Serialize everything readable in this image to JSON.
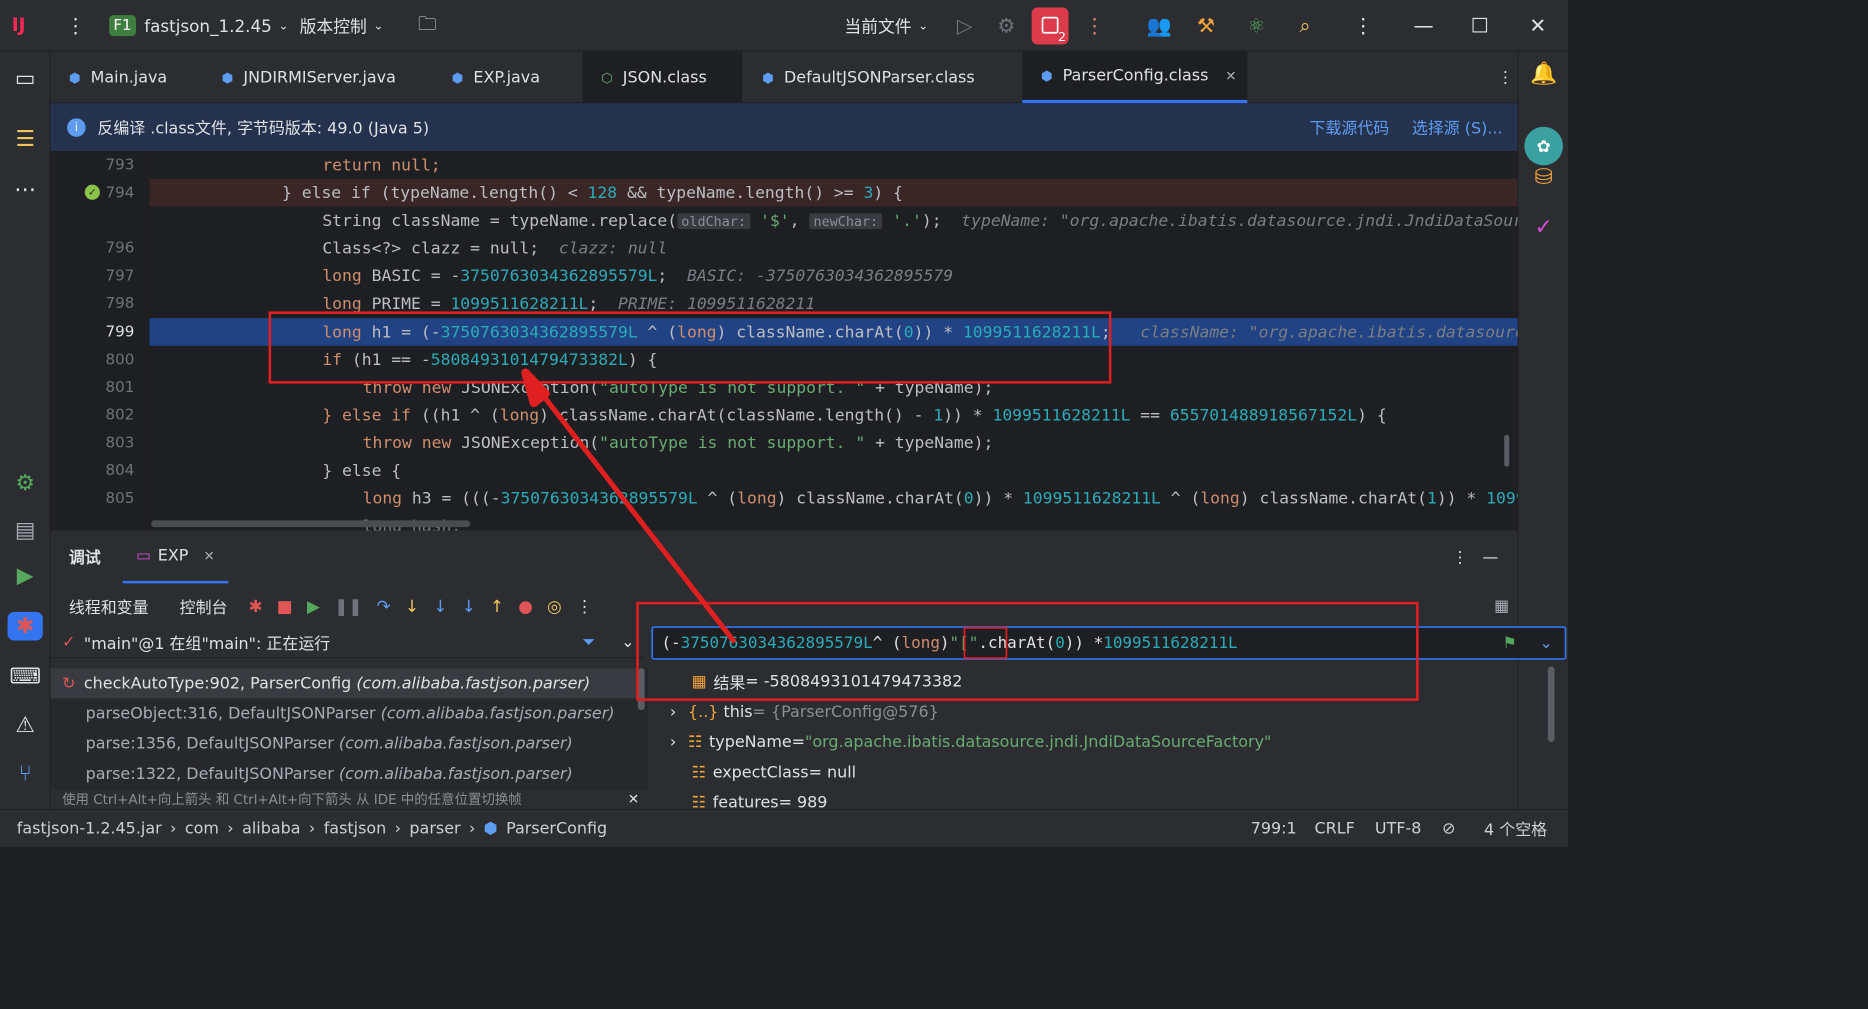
{
  "titlebar": {
    "project": "fastjson_1.2.45",
    "project_badge": "F1",
    "vcs": "版本控制",
    "run_config": "当前文件",
    "notif_count": "2"
  },
  "tabs": [
    "Main.java",
    "JNDIRMIServer.java",
    "EXP.java",
    "JSON.class",
    "DefaultJSONParser.class",
    "ParserConfig.class"
  ],
  "infobar": {
    "text": "反编译 .class文件, 字节码版本: 49.0 (Java 5)",
    "download": "下载源代码",
    "choose": "选择源 (S)..."
  },
  "code": {
    "line_numbers": [
      "793",
      "794",
      "",
      "796",
      "797",
      "798",
      "799",
      "800",
      "801",
      "802",
      "803",
      "804",
      "805"
    ],
    "l793": "return null;",
    "l794a": "} else if (typeName.length() < ",
    "l794b": "128",
    "l794c": " && typeName.length() >= ",
    "l794d": "3",
    "l794e": ") {",
    "l795a": "String className = typeName.replace(",
    "l795h1": "oldChar:",
    "l795s1": "'$'",
    "l795h2": "newChar:",
    "l795s2": "'.'",
    "l795b": ");",
    "l795hint": "typeName: \"org.apache.ibatis.datasource.jndi.JndiDataSource",
    "l796a": "Class<?> clazz = null;",
    "l796hint": "clazz: null",
    "l797a": "long ",
    "l797b": "BASIC = -",
    "l797c": "3750763034362895579L",
    "l797d": ";",
    "l797hint": "BASIC: -3750763034362895579",
    "l798a": "long ",
    "l798b": "PRIME = ",
    "l798c": "1099511628211L",
    "l798d": ";",
    "l798hint": "PRIME: 1099511628211",
    "l799a": "long ",
    "l799b": "h1 = (-",
    "l799c": "3750763034362895579L",
    "l799d": " ^ (",
    "l799e": "long",
    "l799f": ") className.charAt(",
    "l799g": "0",
    "l799h": ")) * ",
    "l799i": "1099511628211L",
    "l799j": ";",
    "l799hint": "className: \"org.apache.ibatis.datasource.",
    "l800a": "if ",
    "l800b": "(h1 == -",
    "l800c": "5808493101479473382L",
    "l800d": ") {",
    "l801a": "throw new ",
    "l801b": "JSONException(",
    "l801c": "\"autoType is not support. \"",
    "l801d": " + typeName);",
    "l802a": "} else if ",
    "l802b": "((h1 ^ (",
    "l802c": "long",
    "l802d": ") className.charAt(className.length() - ",
    "l802e": "1",
    "l802f": ")) * ",
    "l802g": "1099511628211L",
    "l802h": " == ",
    "l802i": "655701488918567152L",
    "l802j": ") {",
    "l803a": "throw new ",
    "l803b": "JSONException(",
    "l803c": "\"autoType is not support. \"",
    "l803d": " + typeName);",
    "l804": "} else {",
    "l805a": "long ",
    "l805b": "h3 = (((-",
    "l805c": "3750763034362895579L",
    "l805d": " ^ (",
    "l805e": "long",
    "l805f": ") className.charAt(",
    "l805g": "0",
    "l805h": ")) * ",
    "l805i": "1099511628211L",
    "l805j": " ^ (",
    "l805k": "long",
    "l805l": ") className.charAt(",
    "l805m": "1",
    "l805n": ")) * ",
    "l805o": "109951",
    "l806": "long hash;"
  },
  "debug": {
    "tab_debug": "调试",
    "tab_exp": "EXP",
    "sub_threads": "线程和变量",
    "sub_console": "控制台",
    "thread": "\"main\"@1 在组\"main\": 正在运行",
    "frames": [
      {
        "m": "checkAutoType:902, ParserConfig",
        "p": "(com.alibaba.fastjson.parser)"
      },
      {
        "m": "parseObject:316, DefaultJSONParser",
        "p": "(com.alibaba.fastjson.parser)"
      },
      {
        "m": "parse:1356, DefaultJSONParser",
        "p": "(com.alibaba.fastjson.parser)"
      },
      {
        "m": "parse:1322, DefaultJSONParser",
        "p": "(com.alibaba.fastjson.parser)"
      }
    ],
    "hint": "使用 Ctrl+Alt+向上箭头 和 Ctrl+Alt+向下箭头 从 IDE 中的任意位置切换帧",
    "eval": {
      "a": "(-",
      "b": "3750763034362895579L",
      "c": " ^ (",
      "d": "long",
      ")": ") ",
      "e": "\"[\"",
      "f": ".",
      "g": "charAt(",
      "h": "0",
      "i": ")) * ",
      "j": "1099511628211L"
    },
    "result_label": "结果",
    "result_value": " = -5808493101479473382",
    "vars": [
      {
        "name": "this",
        "value": " = {ParserConfig@576}"
      },
      {
        "name": "typeName",
        "value": " = ",
        "str": "\"org.apache.ibatis.datasource.jndi.JndiDataSourceFactory\""
      },
      {
        "name": "expectClass",
        "value": " = null"
      },
      {
        "name": "features",
        "value": " = 989"
      }
    ]
  },
  "statusbar": {
    "crumbs": [
      "fastjson-1.2.45.jar",
      "com",
      "alibaba",
      "fastjson",
      "parser",
      "ParserConfig"
    ],
    "pos": "799:1",
    "eol": "CRLF",
    "enc": "UTF-8",
    "indent": "4 个空格"
  }
}
